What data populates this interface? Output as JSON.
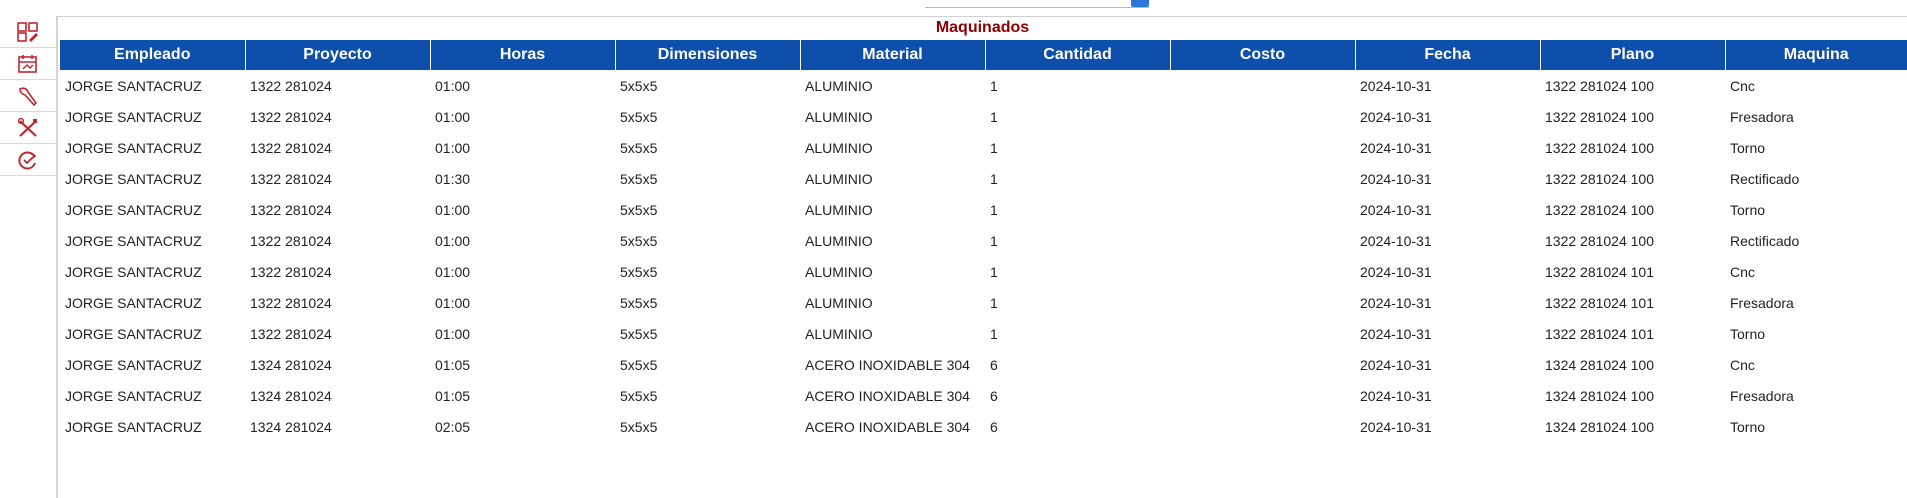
{
  "section_title": "Maquinados",
  "sidebar": {
    "items": [
      {
        "icon": "dashboard-edit-icon"
      },
      {
        "icon": "calendar-icon"
      },
      {
        "icon": "tool-icon"
      },
      {
        "icon": "wrench-screwdriver-icon"
      },
      {
        "icon": "refresh-check-icon"
      }
    ]
  },
  "colors": {
    "header_bg": "#0d4fab",
    "header_text": "#ffffff",
    "title": "#8b0000",
    "icon_red": "#c0282e"
  },
  "table": {
    "columns": [
      "Empleado",
      "Proyecto",
      "Horas",
      "Dimensiones",
      "Material",
      "Cantidad",
      "Costo",
      "Fecha",
      "Plano",
      "Maquina"
    ],
    "rows": [
      [
        "JORGE SANTACRUZ",
        "1322 281024",
        "01:00",
        "5x5x5",
        "ALUMINIO",
        "1",
        "",
        "2024-10-31",
        "1322 281024 100",
        "Cnc"
      ],
      [
        "JORGE SANTACRUZ",
        "1322 281024",
        "01:00",
        "5x5x5",
        "ALUMINIO",
        "1",
        "",
        "2024-10-31",
        "1322 281024 100",
        "Fresadora"
      ],
      [
        "JORGE SANTACRUZ",
        "1322 281024",
        "01:00",
        "5x5x5",
        "ALUMINIO",
        "1",
        "",
        "2024-10-31",
        "1322 281024 100",
        "Torno"
      ],
      [
        "JORGE SANTACRUZ",
        "1322 281024",
        "01:30",
        "5x5x5",
        "ALUMINIO",
        "1",
        "",
        "2024-10-31",
        "1322 281024 100",
        "Rectificado"
      ],
      [
        "JORGE SANTACRUZ",
        "1322 281024",
        "01:00",
        "5x5x5",
        "ALUMINIO",
        "1",
        "",
        "2024-10-31",
        "1322 281024 100",
        "Torno"
      ],
      [
        "JORGE SANTACRUZ",
        "1322 281024",
        "01:00",
        "5x5x5",
        "ALUMINIO",
        "1",
        "",
        "2024-10-31",
        "1322 281024 100",
        "Rectificado"
      ],
      [
        "JORGE SANTACRUZ",
        "1322 281024",
        "01:00",
        "5x5x5",
        "ALUMINIO",
        "1",
        "",
        "2024-10-31",
        "1322 281024 101",
        "Cnc"
      ],
      [
        "JORGE SANTACRUZ",
        "1322 281024",
        "01:00",
        "5x5x5",
        "ALUMINIO",
        "1",
        "",
        "2024-10-31",
        "1322 281024 101",
        "Fresadora"
      ],
      [
        "JORGE SANTACRUZ",
        "1322 281024",
        "01:00",
        "5x5x5",
        "ALUMINIO",
        "1",
        "",
        "2024-10-31",
        "1322 281024 101",
        "Torno"
      ],
      [
        "JORGE SANTACRUZ",
        "1324 281024",
        "01:05",
        "5x5x5",
        "ACERO INOXIDABLE 304",
        "6",
        "",
        "2024-10-31",
        "1324 281024 100",
        "Cnc"
      ],
      [
        "JORGE SANTACRUZ",
        "1324 281024",
        "01:05",
        "5x5x5",
        "ACERO INOXIDABLE 304",
        "6",
        "",
        "2024-10-31",
        "1324 281024 100",
        "Fresadora"
      ],
      [
        "JORGE SANTACRUZ",
        "1324 281024",
        "02:05",
        "5x5x5",
        "ACERO INOXIDABLE 304",
        "6",
        "",
        "2024-10-31",
        "1324 281024 100",
        "Torno"
      ]
    ]
  }
}
